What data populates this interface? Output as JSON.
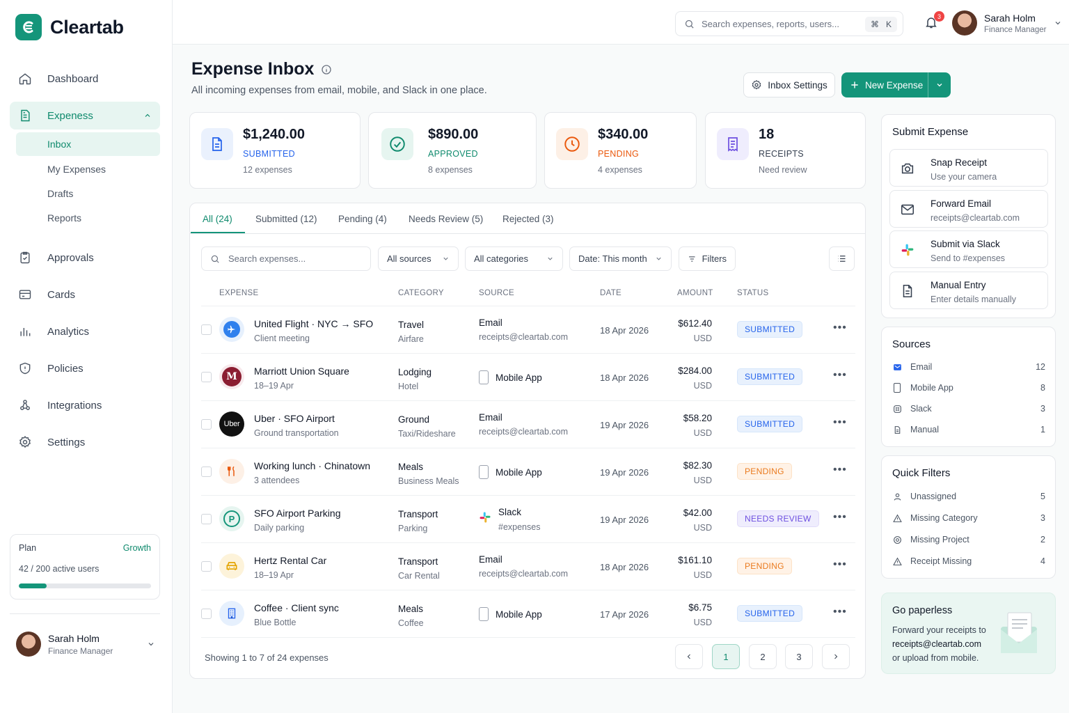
{
  "app": {
    "name": "Cleartab"
  },
  "sidebar": {
    "nav": [
      {
        "label": "Dashboard",
        "icon": "home-icon"
      },
      {
        "label": "Expeness",
        "icon": "receipt-icon"
      },
      {
        "label": "Approvals",
        "icon": "clipboard-check-icon"
      },
      {
        "label": "Cards",
        "icon": "credit-card-icon"
      },
      {
        "label": "Analytics",
        "icon": "bar-chart-icon"
      },
      {
        "label": "Policies",
        "icon": "shield-icon"
      },
      {
        "label": "Integrations",
        "icon": "integrations-icon"
      },
      {
        "label": "Settings",
        "icon": "gear-icon"
      }
    ],
    "sub_nav": [
      {
        "label": "Inbox"
      },
      {
        "label": "My Expenses"
      },
      {
        "label": "Drafts"
      },
      {
        "label": "Reports"
      }
    ],
    "plan": {
      "label": "Plan",
      "tier": "Growth",
      "users": "42 / 200 active users",
      "usage_fraction": 0.21
    },
    "user": {
      "name": "Sarah Holm",
      "role": "Finance Manager"
    }
  },
  "topbar": {
    "search_placeholder": "Search expenses, reports, users...",
    "shortcut_cmd": "⌘",
    "shortcut_key": "K",
    "notification_count": "3",
    "user": {
      "name": "Sarah Holm",
      "role": "Finance Manager"
    }
  },
  "header": {
    "title": "Expense Inbox",
    "subtitle": "All incoming expenses from email, mobile, and Slack in one place.",
    "settings_label": "Inbox Settings",
    "new_label": "New Expense"
  },
  "stats": [
    {
      "value": "$1,240.00",
      "label": "SUBMITTED",
      "sub": "12 expenses",
      "color": "#2563eb"
    },
    {
      "value": "$890.00",
      "label": "APPROVED",
      "sub": "8 expenses",
      "color": "#0f8a6d"
    },
    {
      "value": "$340.00",
      "label": "PENDING",
      "sub": "4 expenses",
      "color": "#ea580c"
    },
    {
      "value": "18",
      "label": "RECEIPTS",
      "sub": "Need review",
      "color": "#374151"
    }
  ],
  "tabs": [
    {
      "label": "All (24)"
    },
    {
      "label": "Submitted (12)"
    },
    {
      "label": "Pending (4)"
    },
    {
      "label": "Needs Review (5)"
    },
    {
      "label": "Rejected (3)"
    }
  ],
  "filters": {
    "search_placeholder": "Search expenses...",
    "sources": "All sources",
    "categories": "All categories",
    "date": "Date: This month",
    "filters_label": "Filters"
  },
  "table": {
    "columns": [
      "EXPENSE",
      "CATEGORY",
      "SOURCE",
      "DATE",
      "AMOUNT",
      "STATUS"
    ],
    "rows": [
      {
        "title": "United Flight · NYC → SFO",
        "subtitle": "Client meeting",
        "category": "Travel",
        "subcategory": "Airfare",
        "source": "Email",
        "source_detail": "receipts@cleartab.com",
        "date": "18 Apr 2026",
        "amount": "$612.40",
        "currency": "USD",
        "status": "SUBMITTED"
      },
      {
        "title": "Marriott Union Square",
        "subtitle": "18–19 Apr",
        "category": "Lodging",
        "subcategory": "Hotel",
        "source": "Mobile App",
        "source_detail": "",
        "date": "18 Apr 2026",
        "amount": "$284.00",
        "currency": "USD",
        "status": "SUBMITTED"
      },
      {
        "title": "Uber · SFO Airport",
        "subtitle": "Ground transportation",
        "category": "Ground",
        "subcategory": "Taxi/Rideshare",
        "source": "Email",
        "source_detail": "receipts@cleartab.com",
        "date": "19 Apr 2026",
        "amount": "$58.20",
        "currency": "USD",
        "status": "SUBMITTED"
      },
      {
        "title": "Working lunch · Chinatown",
        "subtitle": "3 attendees",
        "category": "Meals",
        "subcategory": "Business Meals",
        "source": "Mobile App",
        "source_detail": "",
        "date": "19 Apr 2026",
        "amount": "$82.30",
        "currency": "USD",
        "status": "PENDING"
      },
      {
        "title": "SFO Airport Parking",
        "subtitle": "Daily parking",
        "category": "Transport",
        "subcategory": "Parking",
        "source": "Slack",
        "source_detail": "#expenses",
        "date": "19 Apr 2026",
        "amount": "$42.00",
        "currency": "USD",
        "status": "NEEDS REVIEW"
      },
      {
        "title": "Hertz Rental Car",
        "subtitle": "18–19 Apr",
        "category": "Transport",
        "subcategory": "Car Rental",
        "source": "Email",
        "source_detail": "receipts@cleartab.com",
        "date": "18 Apr 2026",
        "amount": "$161.10",
        "currency": "USD",
        "status": "PENDING"
      },
      {
        "title": "Coffee · Client sync",
        "subtitle": "Blue Bottle",
        "category": "Meals",
        "subcategory": "Coffee",
        "source": "Mobile App",
        "source_detail": "",
        "date": "17 Apr 2026",
        "amount": "$6.75",
        "currency": "USD",
        "status": "SUBMITTED"
      }
    ]
  },
  "pagination": {
    "info": "Showing 1 to 7 of 24 expenses",
    "pages": [
      "1",
      "2",
      "3"
    ],
    "current": "1"
  },
  "submit_expense": {
    "title": "Submit Expense",
    "options": [
      {
        "title": "Snap Receipt",
        "subtitle": "Use your camera",
        "icon": "camera-icon"
      },
      {
        "title": "Forward Email",
        "subtitle": "receipts@cleartab.com",
        "icon": "mail-icon"
      },
      {
        "title": "Submit via Slack",
        "subtitle": "Send to #expenses",
        "icon": "slack-icon"
      },
      {
        "title": "Manual Entry",
        "subtitle": "Enter details manually",
        "icon": "document-icon"
      }
    ]
  },
  "sources": {
    "title": "Sources",
    "items": [
      {
        "label": "Email",
        "count": "12"
      },
      {
        "label": "Mobile App",
        "count": "8"
      },
      {
        "label": "Slack",
        "count": "3"
      },
      {
        "label": "Manual",
        "count": "1"
      }
    ]
  },
  "quick_filters": {
    "title": "Quick Filters",
    "items": [
      {
        "label": "Unassigned",
        "count": "5"
      },
      {
        "label": "Missing Category",
        "count": "3"
      },
      {
        "label": "Missing Project",
        "count": "2"
      },
      {
        "label": "Receipt Missing",
        "count": "4"
      }
    ]
  },
  "paperless": {
    "title": "Go paperless",
    "line1": "Forward your receipts to",
    "email": "receipts@cleartab.com",
    "line3": "or upload from mobile."
  }
}
